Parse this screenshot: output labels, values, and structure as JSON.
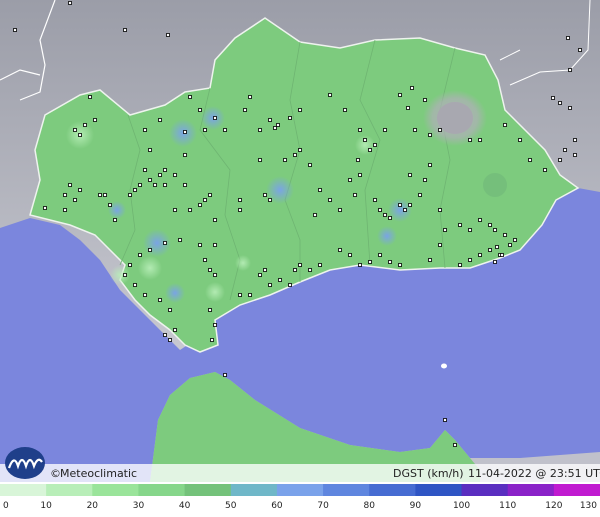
{
  "credit": {
    "copyright_symbol": "©",
    "brand": "Meteoclimatic"
  },
  "caption": {
    "variable": "DGST (km/h)",
    "datetime": "11-04-2022 @ 23:51 UTC"
  },
  "legend": {
    "tick_labels": [
      "0",
      "10",
      "20",
      "30",
      "40",
      "50",
      "60",
      "70",
      "80",
      "90",
      "100",
      "110",
      "120",
      "130"
    ],
    "colors": [
      "#d8f5d8",
      "#b8eeb8",
      "#9ae49a",
      "#86d68a",
      "#74c27a",
      "#6fb7c8",
      "#7aa2ea",
      "#5f86df",
      "#466cd2",
      "#2f55c4",
      "#5a2ec0",
      "#8a22c8",
      "#c01ad0",
      "#e81ee0"
    ]
  },
  "map_colors": {
    "sea": "#7b86dd",
    "land_background": "#b5b7c2",
    "region": "#7dcb7e",
    "high_gust": "#a8a8b0"
  }
}
